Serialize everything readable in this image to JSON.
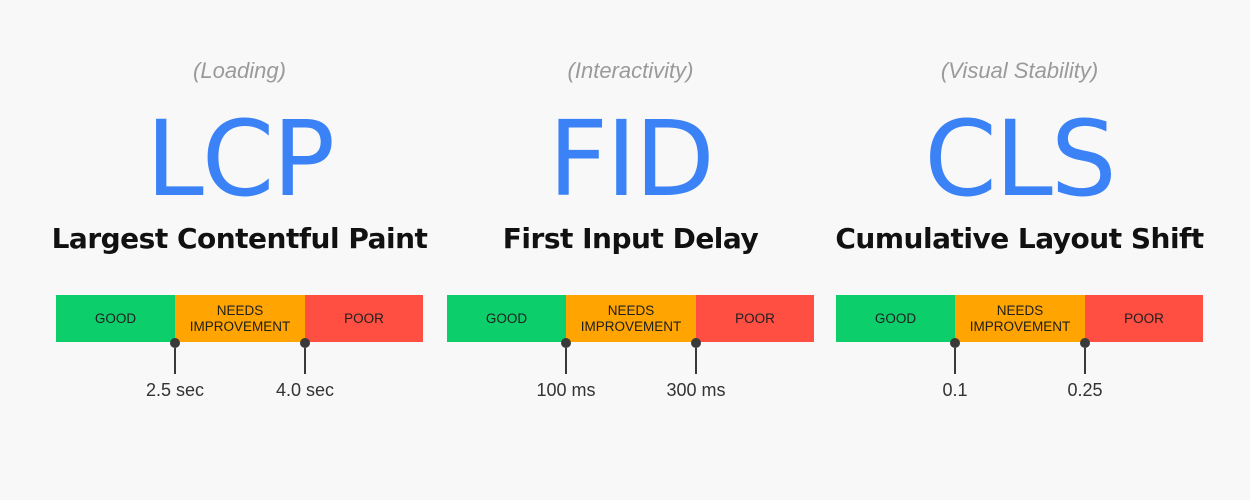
{
  "colors": {
    "good": "#0ccf6b",
    "needs_improvement": "#ffa400",
    "poor": "#ff4e42",
    "accent": "#3b82f6"
  },
  "segments": {
    "good": "GOOD",
    "needs_improvement": "NEEDS\nIMPROVEMENT",
    "poor": "POOR"
  },
  "metrics": [
    {
      "category": "(Loading)",
      "abbr": "LCP",
      "name": "Largest Contentful Paint",
      "thresholds": [
        "2.5 sec",
        "4.0 sec"
      ]
    },
    {
      "category": "(Interactivity)",
      "abbr": "FID",
      "name": "First Input Delay",
      "thresholds": [
        "100 ms",
        "300 ms"
      ]
    },
    {
      "category": "(Visual Stability)",
      "abbr": "CLS",
      "name": "Cumulative Layout Shift",
      "thresholds": [
        "0.1",
        "0.25"
      ]
    }
  ]
}
